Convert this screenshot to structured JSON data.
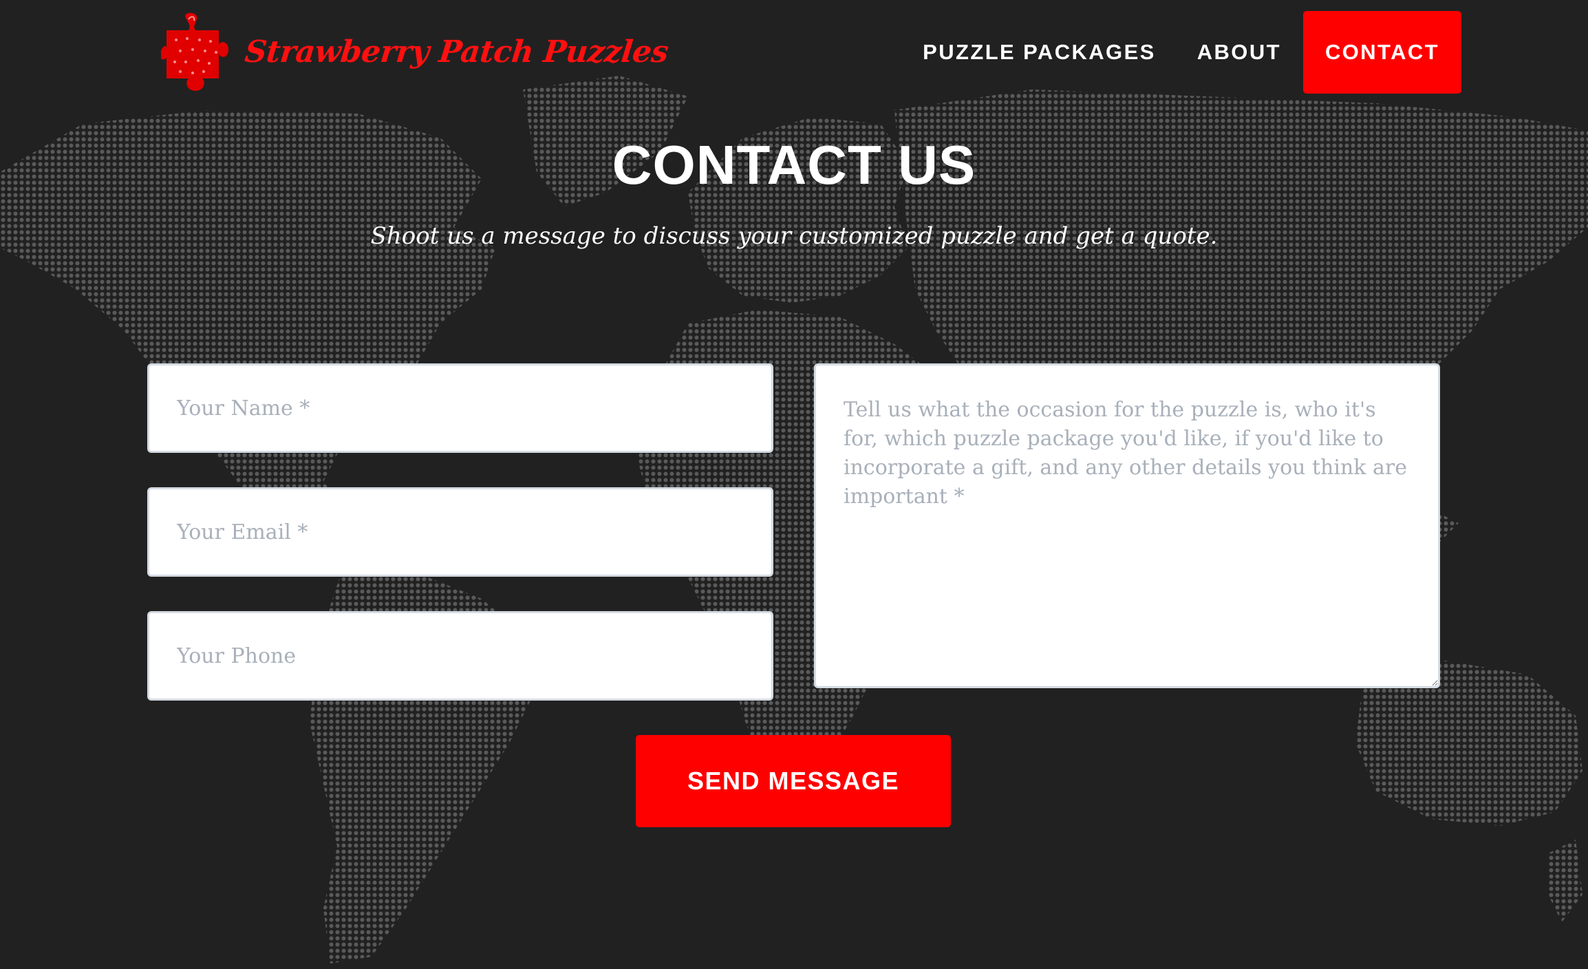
{
  "header": {
    "brand_name": "Strawberry Patch Puzzles",
    "logo_icon": "strawberry-puzzle-piece-icon",
    "nav": [
      {
        "label": "PUZZLE PACKAGES"
      },
      {
        "label": "ABOUT"
      },
      {
        "label": "CONTACT"
      }
    ],
    "active_nav": "CONTACT"
  },
  "main": {
    "title": "CONTACT US",
    "subtitle": "Shoot us a message to discuss your customized puzzle and get a quote."
  },
  "form": {
    "name_placeholder": "Your Name *",
    "email_placeholder": "Your Email *",
    "phone_placeholder": "Your Phone",
    "message_placeholder": "Tell us what the occasion for the puzzle is, who it's for, which puzzle package you'd like, if you'd like to incorporate a gift, and any other details you think are important *",
    "submit_label": "SEND MESSAGE"
  },
  "colors": {
    "background": "#212121",
    "accent": "#ff0000",
    "text": "#ffffff",
    "placeholder": "#a8b0ba",
    "map_dots": "#5a5a5a"
  }
}
